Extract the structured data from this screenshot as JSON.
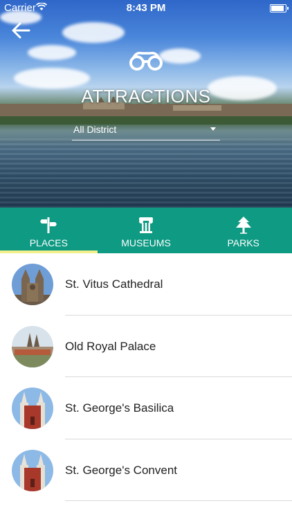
{
  "status_bar": {
    "carrier": "Carrier",
    "time": "8:43 PM",
    "battery_level": 1.0
  },
  "header": {
    "title": "ATTRACTIONS",
    "district_select": "All District"
  },
  "tabs": [
    {
      "label": "PLACES",
      "icon": "signpost-icon",
      "active": true
    },
    {
      "label": "MUSEUMS",
      "icon": "column-icon",
      "active": false
    },
    {
      "label": "PARKS",
      "icon": "tree-icon",
      "active": false
    }
  ],
  "items": [
    {
      "name": "St. Vitus Cathedral",
      "thumb": "cathedral"
    },
    {
      "name": "Old Royal Palace",
      "thumb": "palace"
    },
    {
      "name": "St. George's Basilica",
      "thumb": "basilica"
    },
    {
      "name": "St. George's Convent",
      "thumb": "convent"
    }
  ],
  "colors": {
    "tab_bar": "#0f9a83",
    "active_indicator": "#f3ef8a"
  }
}
